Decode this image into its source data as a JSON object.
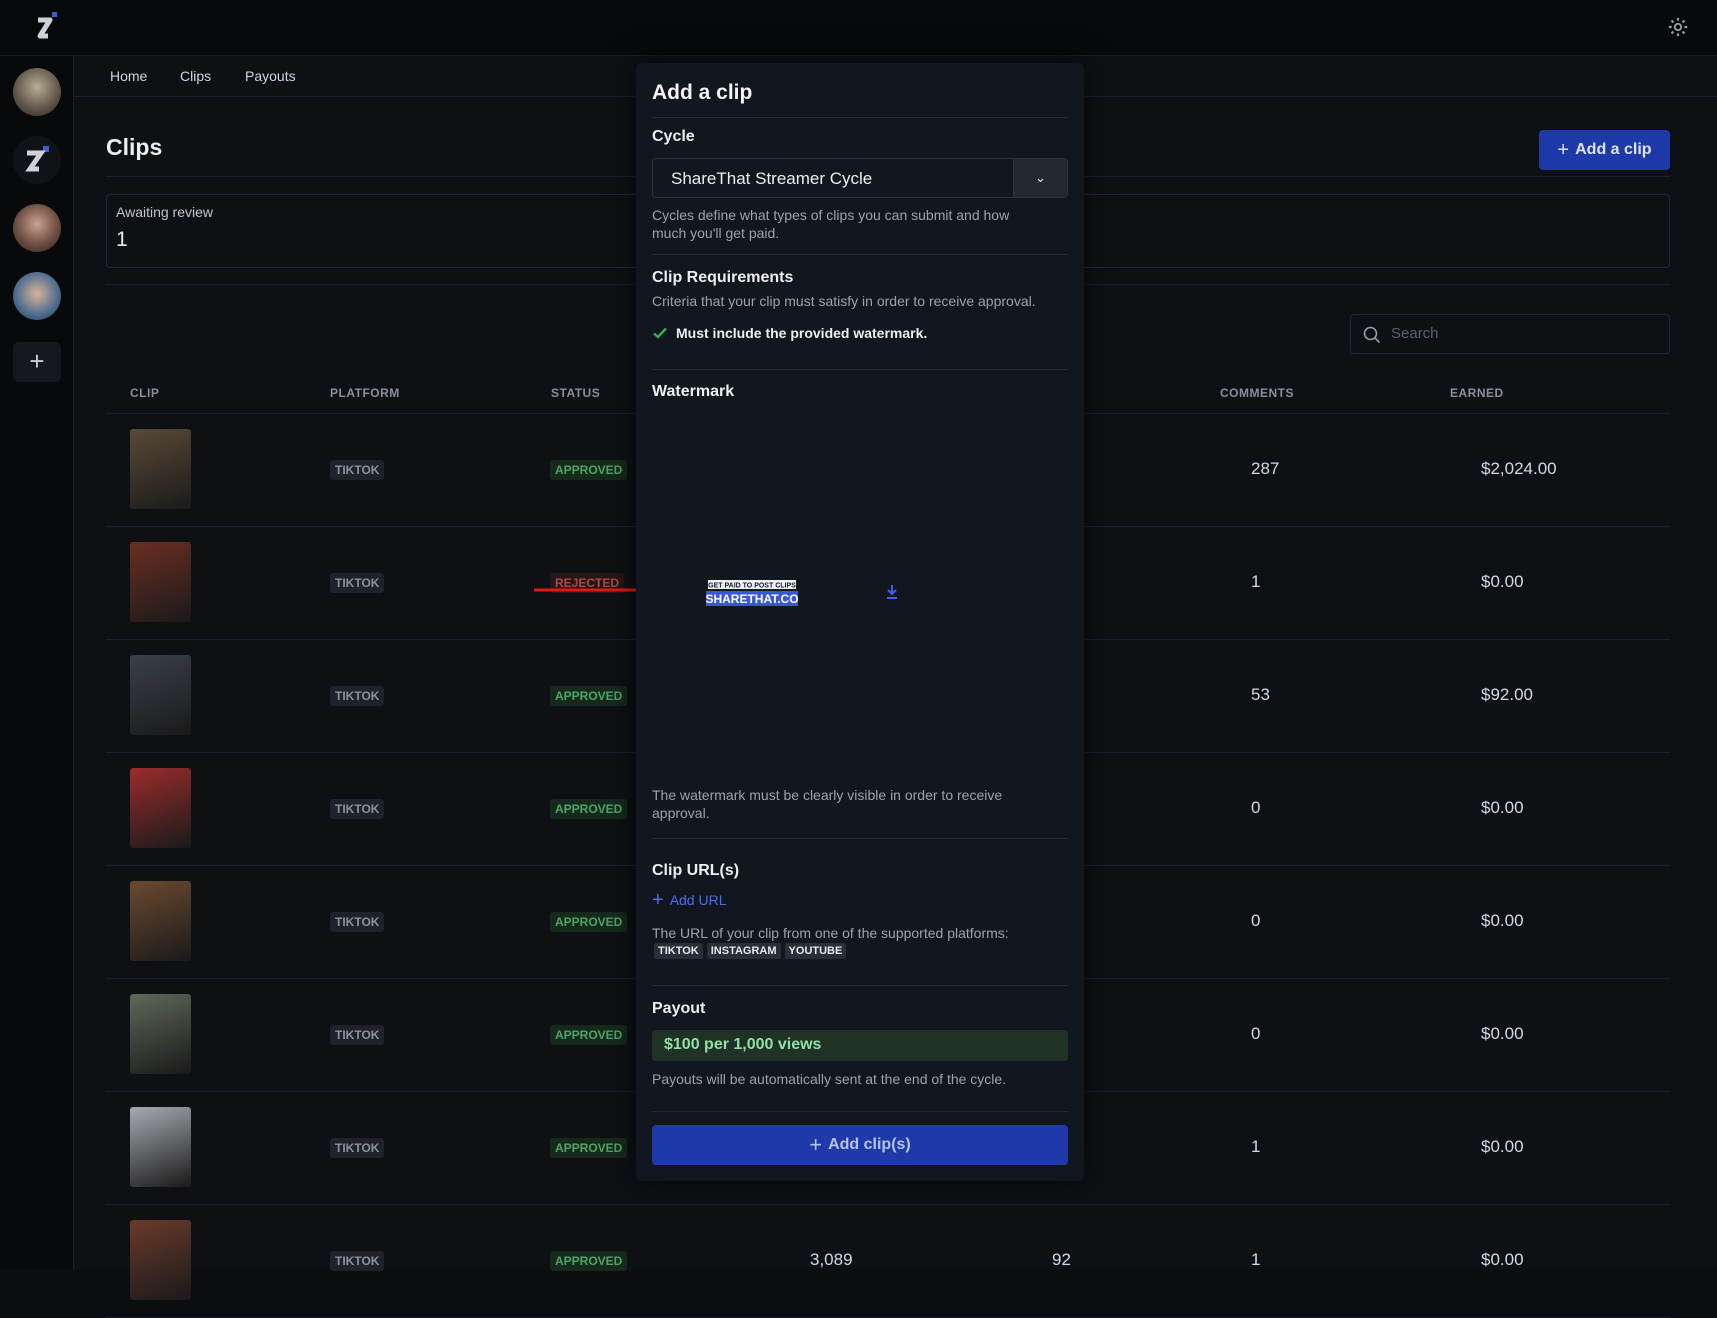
{
  "nav": {
    "home": "Home",
    "clips": "Clips",
    "payouts": "Payouts"
  },
  "page": {
    "title": "Clips",
    "add_button": "Add a clip"
  },
  "stat": {
    "label": "Awaiting review",
    "value": "1"
  },
  "search": {
    "placeholder": "Search"
  },
  "table": {
    "headers": {
      "clip": "CLIP",
      "platform": "PLATFORM",
      "status": "STATUS",
      "comments": "COMMENTS",
      "earned": "EARNED"
    },
    "rows": [
      {
        "platform": "TIKTOK",
        "status": "APPROVED",
        "comments": "287",
        "earned": "$2,024.00",
        "color": "#5a4a36"
      },
      {
        "platform": "TIKTOK",
        "status": "REJECTED",
        "comments": "1",
        "earned": "$0.00",
        "color": "#6b2e22"
      },
      {
        "platform": "TIKTOK",
        "status": "APPROVED",
        "comments": "53",
        "earned": "$92.00",
        "color": "#3a4048"
      },
      {
        "platform": "TIKTOK",
        "status": "APPROVED",
        "comments": "0",
        "earned": "$0.00",
        "color": "#9a2c2c"
      },
      {
        "platform": "TIKTOK",
        "status": "APPROVED",
        "comments": "0",
        "earned": "$0.00",
        "color": "#6a4a30"
      },
      {
        "platform": "TIKTOK",
        "status": "APPROVED",
        "comments": "0",
        "earned": "$0.00",
        "color": "#5f6858"
      },
      {
        "platform": "TIKTOK",
        "status": "APPROVED",
        "comments": "1",
        "earned": "$0.00",
        "color": "#a8aab0"
      },
      {
        "platform": "TIKTOK",
        "status": "APPROVED",
        "views": "3,089",
        "likes": "92",
        "comments": "1",
        "earned": "$0.00",
        "color": "#6a3a2a"
      }
    ]
  },
  "modal": {
    "title": "Add a clip",
    "cycle_heading": "Cycle",
    "cycle_value": "ShareThat Streamer Cycle",
    "cycle_help": "Cycles define what types of clips you can submit and how much you'll get paid.",
    "req_heading": "Clip Requirements",
    "req_help": "Criteria that your clip must satisfy in order to receive approval.",
    "req_item": "Must include the provided watermark.",
    "wm_heading": "Watermark",
    "wm_line1": "GET PAID TO POST CLIPS",
    "wm_line2": "SHARETHAT.CO",
    "wm_help": "The watermark must be clearly visible in order to receive approval.",
    "url_heading": "Clip URL(s)",
    "add_url": "Add URL",
    "url_help": "The URL of your clip from one of the supported platforms:",
    "platforms": [
      "TIKTOK",
      "INSTAGRAM",
      "YOUTUBE"
    ],
    "payout_heading": "Payout",
    "payout_rate": "$100 per 1,000 views",
    "payout_help": "Payouts will be automatically sent at the end of the cycle.",
    "submit": "Add clip(s)"
  }
}
